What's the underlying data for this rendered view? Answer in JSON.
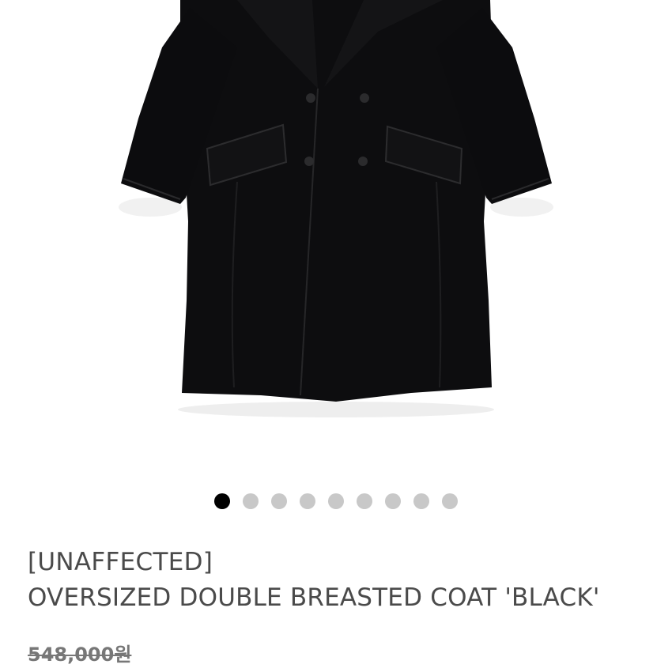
{
  "product": {
    "image": {
      "icon": "coat-image",
      "alt": "black double breasted coat"
    },
    "carousel": {
      "count": 9,
      "active_index": 0
    },
    "brand": "[UNAFFECTED]",
    "title": "OVERSIZED DOUBLE BREASTED COAT 'BLACK'",
    "original_price": "548,000원"
  },
  "colors": {
    "coat": "#0d0d0f",
    "dot_active": "#000000",
    "dot_inactive": "#c8c8c8",
    "text": "#4a4a4a",
    "price": "#777777"
  }
}
